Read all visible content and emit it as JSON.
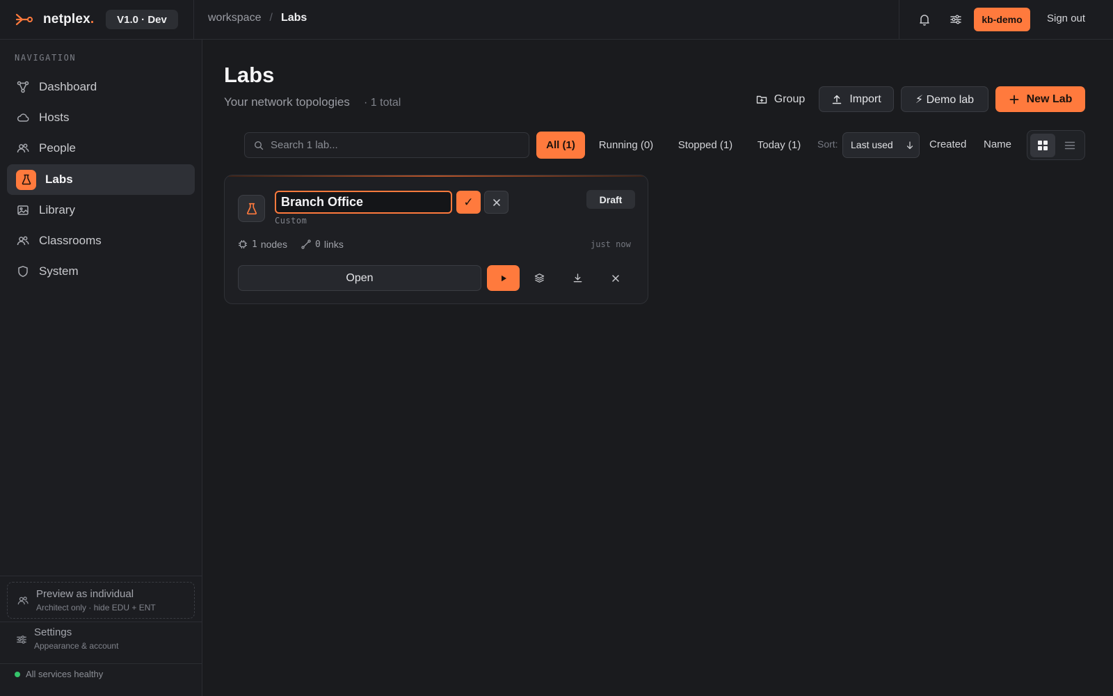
{
  "brand": {
    "name": "netplex",
    "dot": ".",
    "version": "V1.0 · Dev"
  },
  "breadcrumb": {
    "root": "workspace",
    "separator": "/",
    "current": "Labs"
  },
  "topbar": {
    "user": "kb-demo",
    "sign_out": "Sign out",
    "icons": [
      "bell-icon",
      "sliders-icon"
    ]
  },
  "sidebar": {
    "heading": "NAVIGATION",
    "items": [
      {
        "label": "Dashboard",
        "icon": "topology-icon"
      },
      {
        "label": "Hosts",
        "icon": "cloud-icon"
      },
      {
        "label": "People",
        "icon": "people-icon"
      },
      {
        "label": "Labs",
        "icon": "flask-icon",
        "active": true
      },
      {
        "label": "Library",
        "icon": "image-icon"
      },
      {
        "label": "Classrooms",
        "icon": "classroom-icon"
      },
      {
        "label": "System",
        "icon": "shield-icon"
      }
    ],
    "preview": {
      "title": "Preview as individual",
      "subtitle": "Architect only · hide EDU + ENT"
    },
    "settings": {
      "title": "Settings",
      "subtitle": "Appearance & account"
    },
    "health": {
      "label": "All services healthy",
      "color": "#35c46b"
    }
  },
  "main": {
    "title": "Labs",
    "subtitle": "Your network topologies",
    "count": "· 1 total",
    "actions": {
      "group": "Group",
      "import": "Import",
      "demo": "⚡ Demo lab",
      "new": "New Lab"
    },
    "search": {
      "placeholder": "Search 1 lab...",
      "value": ""
    },
    "filters": [
      "All (1)",
      "Running (0)",
      "Stopped (1)",
      "Today (1)"
    ],
    "sort": {
      "label": "Sort:",
      "selected": "Last used",
      "options": [
        "Created",
        "Name"
      ]
    },
    "view": {
      "selected": "grid"
    }
  },
  "lab": {
    "name": "Branch Office",
    "type": "Custom",
    "status": "Draft",
    "nodes": {
      "value": "1",
      "label": "nodes"
    },
    "links": {
      "value": "0",
      "label": "links"
    },
    "time": "just now",
    "confirm_symbol": "✓",
    "open_label": "Open"
  },
  "colors": {
    "accent": "#ff7a3d",
    "background": "#1a1b1e",
    "surface": "#1e1f23"
  }
}
